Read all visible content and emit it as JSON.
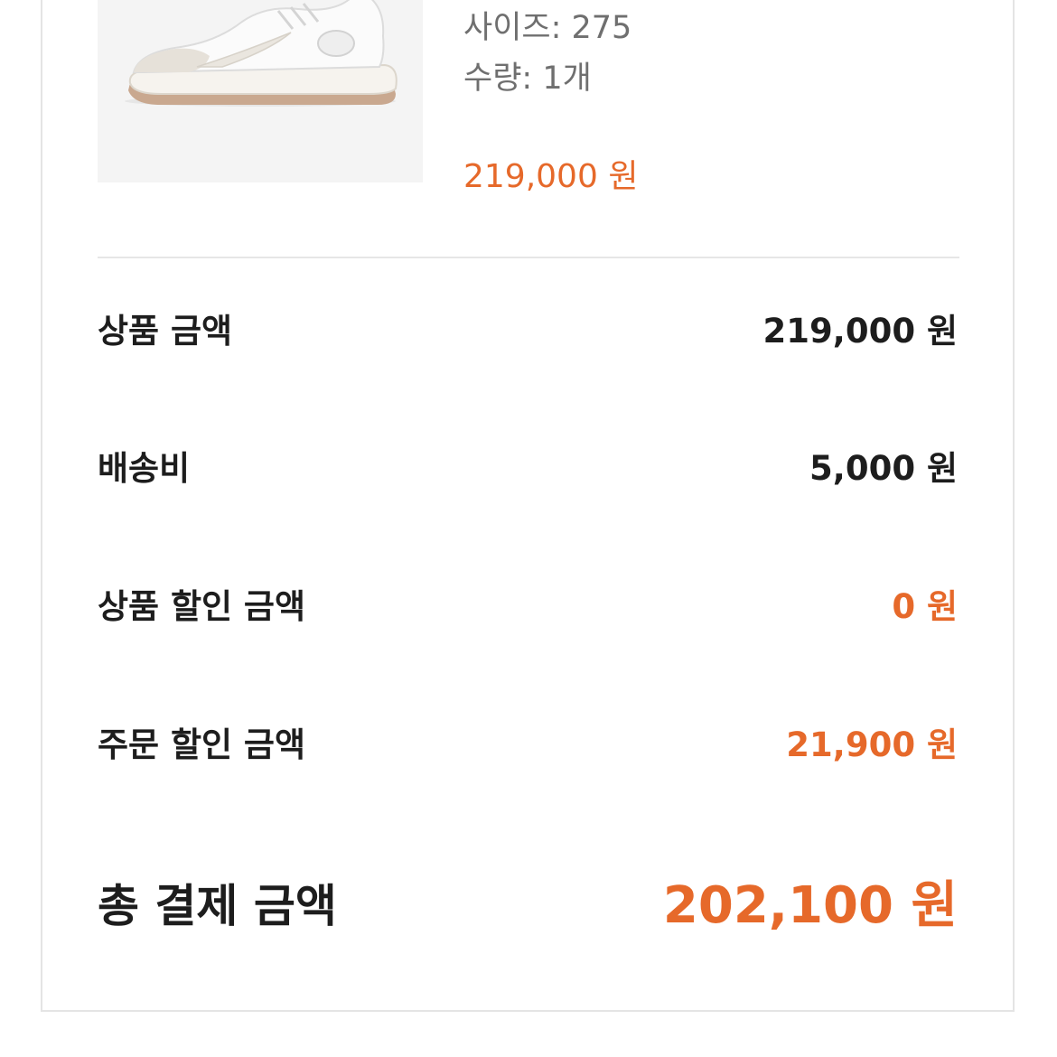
{
  "product": {
    "image_icon": "sneaker-image",
    "size_text": "사이즈: 275",
    "quantity_text": "수량: 1개",
    "price_text": "219,000 원"
  },
  "summary": {
    "rows": [
      {
        "label": "상품 금액",
        "value": "219,000 원",
        "accent": false
      },
      {
        "label": "배송비",
        "value": "5,000 원",
        "accent": false
      },
      {
        "label": "상품 할인 금액",
        "value": "0 원",
        "accent": true
      },
      {
        "label": "주문 할인 금액",
        "value": "21,900 원",
        "accent": true
      }
    ],
    "total": {
      "label": "총 결제 금액",
      "value": "202,100 원"
    }
  },
  "colors": {
    "accent": "#e6692a",
    "text_primary": "#1d1d1d",
    "text_secondary": "#6f6f6f",
    "divider": "#e6e6e6",
    "card_border": "#e4e4e4"
  }
}
